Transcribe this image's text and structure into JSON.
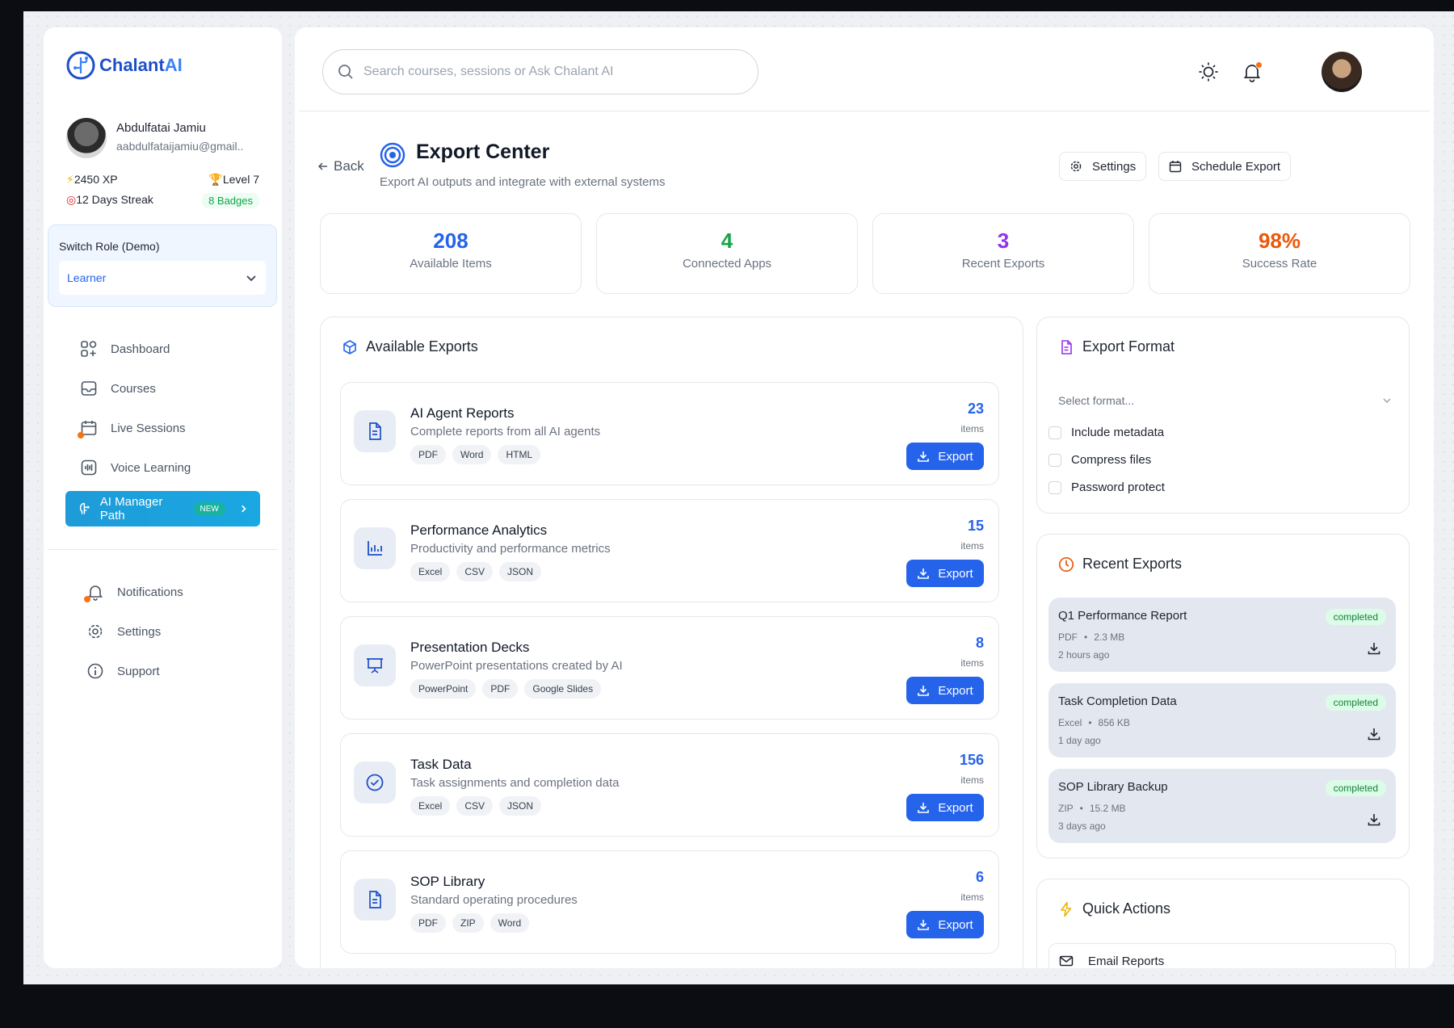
{
  "brand": {
    "name_part1": "Chalant",
    "name_part2": "AI"
  },
  "user": {
    "name": "Abdulfatai Jamiu",
    "email": "aabdulfataijamiu@gmail..",
    "xp": "2450 XP",
    "level": "Level 7",
    "streak": "12 Days Streak",
    "badges": "8 Badges"
  },
  "role": {
    "label": "Switch Role (Demo)",
    "value": "Learner"
  },
  "nav": {
    "dashboard": "Dashboard",
    "courses": "Courses",
    "live_sessions": "Live Sessions",
    "voice_learning": "Voice Learning",
    "ai_manager": "AI Manager Path",
    "ai_manager_tag": "NEW",
    "notifications": "Notifications",
    "settings": "Settings",
    "support": "Support"
  },
  "search": {
    "placeholder": "Search courses, sessions or Ask Chalant AI"
  },
  "page": {
    "back": "Back",
    "title": "Export Center",
    "subtitle": "Export AI outputs and integrate with external systems",
    "settings_btn": "Settings",
    "schedule_btn": "Schedule Export"
  },
  "stats": [
    {
      "value": "208",
      "label": "Available Items",
      "color": "#2563eb"
    },
    {
      "value": "4",
      "label": "Connected Apps",
      "color": "#16a34a"
    },
    {
      "value": "3",
      "label": "Recent Exports",
      "color": "#9333ea"
    },
    {
      "value": "98%",
      "label": "Success Rate",
      "color": "#ea580c"
    }
  ],
  "available": {
    "title": "Available Exports",
    "items_label": "items",
    "export_label": "Export",
    "list": [
      {
        "name": "AI Agent Reports",
        "desc": "Complete reports from all AI agents",
        "count": "23",
        "tags": [
          "PDF",
          "Word",
          "HTML"
        ]
      },
      {
        "name": "Performance Analytics",
        "desc": "Productivity and performance metrics",
        "count": "15",
        "tags": [
          "Excel",
          "CSV",
          "JSON"
        ]
      },
      {
        "name": "Presentation Decks",
        "desc": "PowerPoint presentations created by AI",
        "count": "8",
        "tags": [
          "PowerPoint",
          "PDF",
          "Google Slides"
        ]
      },
      {
        "name": "Task Data",
        "desc": "Task assignments and completion data",
        "count": "156",
        "tags": [
          "Excel",
          "CSV",
          "JSON"
        ]
      },
      {
        "name": "SOP Library",
        "desc": "Standard operating procedures",
        "count": "6",
        "tags": [
          "PDF",
          "ZIP",
          "Word"
        ]
      }
    ]
  },
  "format": {
    "title": "Export Format",
    "placeholder": "Select format...",
    "options": [
      "Include metadata",
      "Compress files",
      "Password protect"
    ]
  },
  "recent": {
    "title": "Recent Exports",
    "list": [
      {
        "name": "Q1 Performance Report",
        "type": "PDF",
        "size": "2.3 MB",
        "time": "2 hours ago",
        "status": "completed"
      },
      {
        "name": "Task Completion Data",
        "type": "Excel",
        "size": "856 KB",
        "time": "1 day ago",
        "status": "completed"
      },
      {
        "name": "SOP Library Backup",
        "type": "ZIP",
        "size": "15.2 MB",
        "time": "3 days ago",
        "status": "completed"
      }
    ]
  },
  "quick": {
    "title": "Quick Actions",
    "email_reports": "Email Reports"
  }
}
